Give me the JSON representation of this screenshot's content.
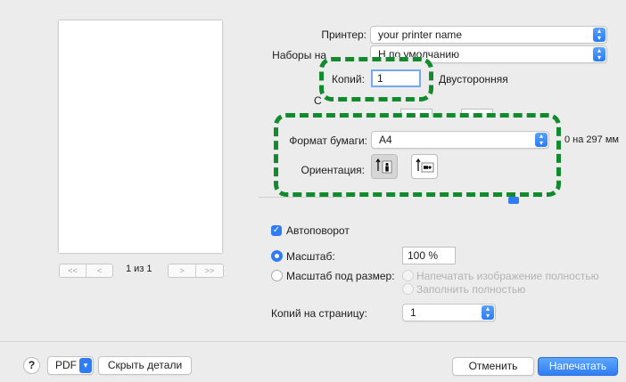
{
  "preview": {
    "first_btn": "<<",
    "prev_btn": "<",
    "page_counter": "1 из 1",
    "next_btn": ">",
    "last_btn": ">>"
  },
  "printer": {
    "label": "Принтер:",
    "value": "your printer name"
  },
  "presets": {
    "label": "Наборы на",
    "value": "Н          по умолчанию"
  },
  "copies": {
    "label": "Копий:",
    "value": "1",
    "two_sided_label": "Двусторонняя"
  },
  "pages_label_partial": "С",
  "paper_size": {
    "label": "Формат бумаги:",
    "value": "A4",
    "size_text": "0 на 297 мм"
  },
  "orientation": {
    "label": "Ориентация:"
  },
  "autorotate": {
    "label": "Автоповорот",
    "checked": true
  },
  "scale": {
    "label": "Масштаб:",
    "value": "100 %"
  },
  "scale_to_fit": {
    "label": "Масштаб под размер:",
    "option_fill_image": "Напечатать изображение полностью",
    "option_fill_page": "Заполнить полностью"
  },
  "copies_per_page": {
    "label": "Копий на страницу:",
    "value": "1"
  },
  "footer": {
    "help": "?",
    "pdf": "PDF",
    "hide_details": "Скрыть детали",
    "cancel": "Отменить",
    "print": "Напечатать"
  },
  "colors": {
    "accent": "#2f7cf6",
    "highlight": "#128a2e"
  }
}
